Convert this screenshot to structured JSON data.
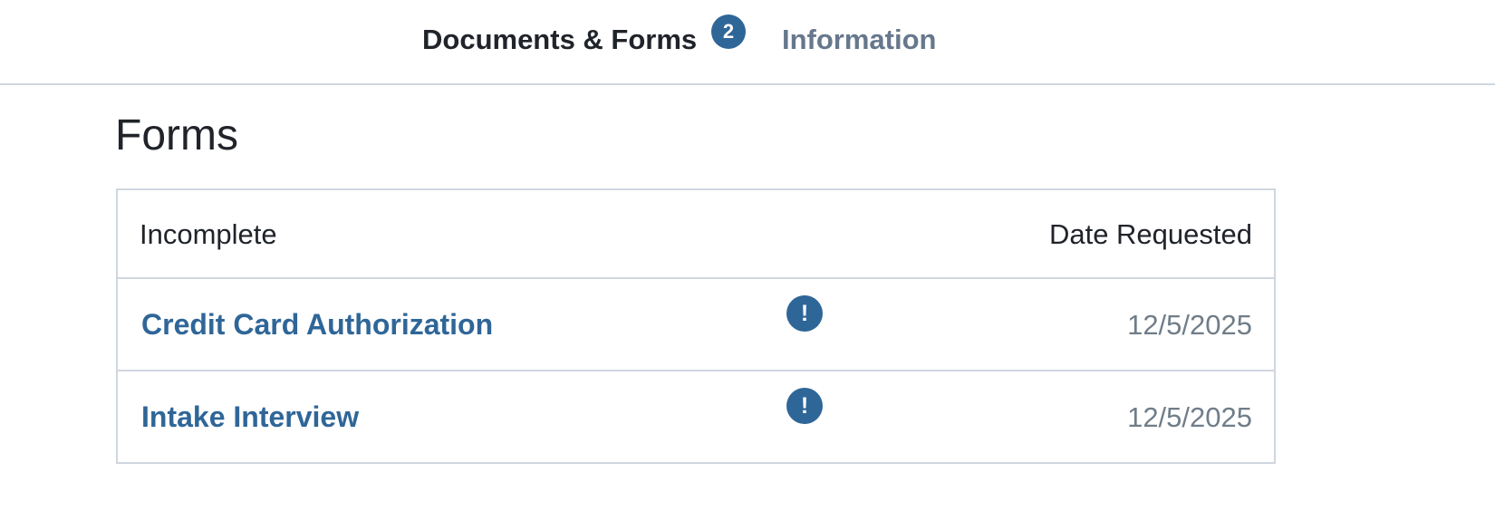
{
  "tabs": {
    "documents_label": "Documents & Forms",
    "documents_badge": "2",
    "information_label": "Information"
  },
  "forms": {
    "title": "Forms",
    "column_incomplete": "Incomplete",
    "column_date_requested": "Date Requested",
    "rows": [
      {
        "name": "Credit Card Authorization",
        "status_icon": "exclamation-icon",
        "status_symbol": "!",
        "date": "12/5/2025"
      },
      {
        "name": "Intake Interview",
        "status_icon": "exclamation-icon",
        "status_symbol": "!",
        "date": "12/5/2025"
      }
    ]
  },
  "colors": {
    "accent": "#2f6698",
    "inactive_tab": "#66788d",
    "border": "#cfd7de",
    "date_text": "#707d89"
  }
}
